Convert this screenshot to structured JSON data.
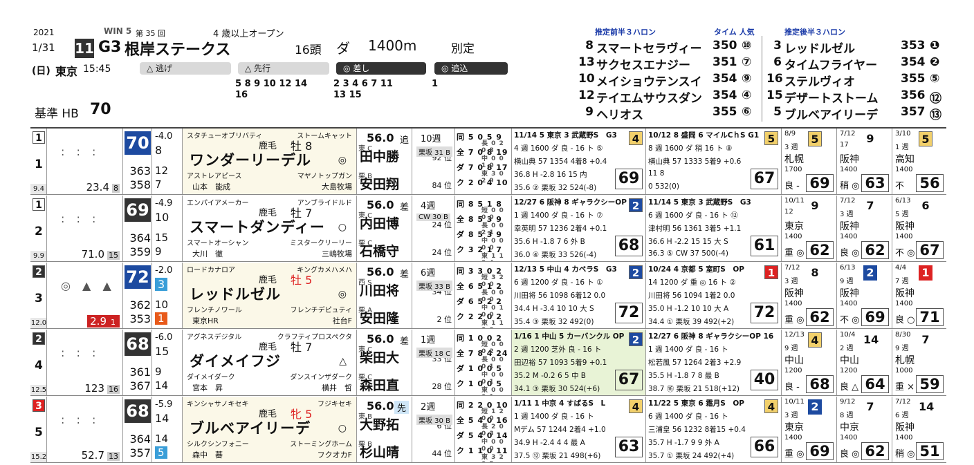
{
  "header": {
    "year": "2021",
    "date": "1/31",
    "win5": "WIN 5",
    "kai": "第 35 回",
    "cond": "4 歳以上オープン",
    "race_no": "11",
    "grade": "G3",
    "race_name": "根岸ステークス",
    "heads": "16頭",
    "surface": "ダ",
    "distance": "1400m",
    "weight_rule": "別定",
    "day": "(日)",
    "venue": "東京",
    "time": "15:45",
    "base_label": "基準 HB",
    "base_value": "70"
  },
  "pace": [
    {
      "label": "△ 逃げ",
      "nums1": "",
      "nums2": ""
    },
    {
      "label": "△ 先行",
      "nums1": "5 8 9 10 12 14",
      "nums2": "16"
    },
    {
      "label": "◎ 差し",
      "nums1": "2 3 4 6 7 11",
      "nums2": "13 15"
    },
    {
      "label": "◎ 追込",
      "nums1": "1",
      "nums2": ""
    }
  ],
  "pred_front": {
    "title": "推定前半３ハロン",
    "col": "タイム 人気",
    "rows": [
      {
        "no": "8",
        "name": "スマートセラヴィー",
        "time": "350",
        "pop": "⑩"
      },
      {
        "no": "13",
        "name": "サクセスエナジー",
        "time": "351",
        "pop": "⑦"
      },
      {
        "no": "10",
        "name": "メイショウテンスイ",
        "time": "354",
        "pop": "⑨"
      },
      {
        "no": "12",
        "name": "テイエムサウスダン",
        "time": "354",
        "pop": "④"
      },
      {
        "no": "9",
        "name": "ヘリオス",
        "time": "355",
        "pop": "⑥"
      }
    ]
  },
  "pred_back": {
    "title": "推定後半３ハロン",
    "rows": [
      {
        "no": "3",
        "name": "レッドルゼル",
        "time": "353",
        "pop": "❶"
      },
      {
        "no": "6",
        "name": "タイムフライヤー",
        "time": "354",
        "pop": "❷"
      },
      {
        "no": "16",
        "name": "ステルヴィオ",
        "time": "355",
        "pop": "⑤"
      },
      {
        "no": "15",
        "name": "デザートストーム",
        "time": "356",
        "pop": "⑫"
      },
      {
        "no": "5",
        "name": "ブルベアイリーデ",
        "time": "357",
        "pop": "⑬"
      }
    ]
  },
  "horses": [
    {
      "waku": "1",
      "umaban": "1",
      "odds_rank": "9.4",
      "marks": ": : :",
      "odds": "23.4",
      "pop": "8",
      "index": "70",
      "idx_style": "blue",
      "d1": "-4.0",
      "d1b": "8",
      "r1": "363",
      "r1b": "12",
      "r2": "358",
      "r2b": "7",
      "sire": "スタチューオブリバティ",
      "sire2": "ストームキャット",
      "coat": "鹿毛",
      "sex": "牡 8",
      "name": "ワンダーリーデル",
      "mark": "◎",
      "dam": "アストレアピース",
      "dam2": "マヤノトップガン",
      "trainer": "山本　能成",
      "owner": "大島牧場",
      "weight": "56.0",
      "style": "追",
      "j_tag": "東 C",
      "jockey": "田中勝",
      "j_rank": "92 位",
      "j2_tag": "栗 B",
      "jockey2": "安田翔",
      "j2_rank": "84 位",
      "week": "10週",
      "train": "栗坂 31 B",
      "stats": [
        "同 5 0 5 9",
        "全 7 0 8 19",
        "ダ 7 0 8 17",
        "ク 2 0 4 10"
      ],
      "stats2": [
        "長 0 2 0 8",
        "中 0 0 1 0",
        "東 3 0 2 9",
        ""
      ],
      "pr1": [
        "11/14 5 東京 3 武蔵野S　G3",
        "4 週 1600 ダ 良 - 16 ト ⑤",
        "横山典 57 1354 4着8 +0.4",
        "36.8 H -2.8 16 15 内",
        "35.6 ② 栗坂 32 524(-8)"
      ],
      "pr1_score": "69",
      "pr1_rank": "4",
      "pr1_style": "",
      "pr2": [
        "10/12 8 盛岡 6 マイルCｈS G1",
        "8 週 1600 ダ 稍 16 ト ⑧",
        "横山典 57 1333 5着9 +0.6",
        "11 8",
        "0 532(0)"
      ],
      "pr2_score": "67",
      "pr2_rank": "5",
      "pr2_style": "",
      "m1": [
        "8/9",
        "3 週",
        "札幌",
        "1700",
        "良 -"
      ],
      "m1_rank": "5",
      "m1_style": "boxed",
      "m1_score": "69",
      "m2": [
        "7/12",
        "17",
        "阪神",
        "1400",
        "稍 ◎"
      ],
      "m2_rank": "9",
      "m2_style": "",
      "m2_score": "63",
      "m3": [
        "3/10",
        "1 週",
        "高知",
        "1400",
        "不"
      ],
      "m3_rank": "5",
      "m3_style": "boxed",
      "m3_score": "56"
    },
    {
      "waku": "1",
      "umaban": "2",
      "odds_rank": "9.9",
      "marks": ": : :",
      "odds": "71.0",
      "pop": "15",
      "index": "69",
      "idx_style": "dark",
      "d1": "-4.9",
      "d1b": "10",
      "r1": "364",
      "r1b": "15",
      "r2": "359",
      "r2b": "9",
      "sire": "エンパイアメーカー",
      "sire2": "アンブライドルド",
      "coat": "鹿毛",
      "sex": "牡 7",
      "name": "スマートダンディー",
      "mark": "○",
      "dam": "スマートオーシャン",
      "dam2": "ミスタークリーリー",
      "trainer": "大川　徹",
      "owner": "三嶋牧場",
      "weight": "56.0",
      "style": "差",
      "j_tag": "東 C",
      "jockey": "内田博",
      "j_rank": "24 位",
      "j2_tag": "栗 C",
      "jockey2": "石橋守",
      "j2_rank": "24 位",
      "week": "4週",
      "train": "CW 30 B",
      "stats": [
        "同 8 5 1 8",
        "全 8 5 3 9",
        "ダ 8 5 3 9",
        "ク 3 2 1 7"
      ],
      "stats2": [
        "短 0 0 0 0",
        "長 0 0 2 1",
        "中 0 0 0 0",
        "東 1 1 3 4"
      ],
      "pr1": [
        "12/27 6 阪神 8 ギャラクシーOP",
        "1 週 1400 ダ 良 - 16 ト ⑦",
        "幸英明 57 1236 2着4 +0.1",
        "35.6 H -1.8 7 6 外 B",
        "36.0 ④ 栗坂 33 526(-4)"
      ],
      "pr1_score": "68",
      "pr1_rank": "2",
      "pr1_style": "blue",
      "pr2": [
        "11/14 5 東京 3 武蔵野S　G3",
        "6 週 1600 ダ 良 - 16 ト ⑫",
        "津村明 56 1361 3着5 +1.1",
        "36.6 H -2.2 15 15 大 S",
        "36.3 ⑤ CW 37 500(-4)"
      ],
      "pr2_score": "61",
      "pr2_rank": "",
      "pr2_style": "",
      "m1": [
        "10/11",
        "12",
        "東京",
        "1400",
        "重 ◎"
      ],
      "m1_rank": "9",
      "m1_style": "",
      "m1_score": "62",
      "m2": [
        "7/12",
        "3 週",
        "阪神",
        "1400",
        "良 ◎"
      ],
      "m2_rank": "7",
      "m2_style": "",
      "m2_score": "62",
      "m3": [
        "6/13",
        "5 週",
        "阪神",
        "1400",
        "不 ◎"
      ],
      "m3_rank": "6",
      "m3_style": "",
      "m3_score": "67"
    },
    {
      "waku": "2",
      "umaban": "3",
      "odds_rank": "12.0",
      "marks": "◎ ▲ ▲",
      "odds": "2.9",
      "pop": "1",
      "index": "72",
      "idx_style": "blue",
      "d1": "-2.0",
      "d1b": "3",
      "r1": "362",
      "r1b": "10",
      "r2": "353",
      "r2b": "1",
      "sire": "ロードカナロア",
      "sire2": "キングカメハメハ",
      "coat": "鹿毛",
      "sex": "牡 5",
      "name": "レッドルゼル",
      "mark": "◎",
      "dam": "フレンチノワール",
      "dam2": "フレンチデピュティ",
      "trainer": "東京HR",
      "owner": "社台F",
      "weight": "56.0",
      "style": "差",
      "j_tag": "西 S",
      "jockey": "川田将",
      "j_rank": "34 位",
      "j2_tag": "栗 A",
      "jockey2": "安田隆",
      "j2_rank": "2 位",
      "week": "6週",
      "train": "栗坂 33 B",
      "stats": [
        "同 3 3 0 2",
        "全 6 5 1 2",
        "ダ 6 5 2 2",
        "ク 2 2 0 2"
      ],
      "stats2": [
        "短 3 2 0 0",
        "長 0 0 0 0",
        "中 0 1 0 0",
        "東 1 1 0 0"
      ],
      "pr1": [
        "12/13 5 中山 4 カペラS　G3",
        "6 週 1200 ダ 良 - 16 ト ①",
        "川田将 56 1098 6着12 0.0",
        "34.4 H -3.4 10 10 大 S",
        "35.4 ③ 栗坂 32 492(0)"
      ],
      "pr1_score": "72",
      "pr1_rank": "2",
      "pr1_style": "blue",
      "pr2": [
        "10/24 4 京都 5 室町S　OP",
        "14 1200 ダ 重 ◎ 16 ト ②",
        "川田将 56 1094 1着2 0.0",
        "35.0 H -1.2 10 10 大 A",
        "34.4 ① 栗坂 39 492(+2)"
      ],
      "pr2_score": "72",
      "pr2_rank": "1",
      "pr2_style": "red",
      "m1": [
        "7/12",
        "3 週",
        "阪神",
        "1400",
        "重 ◎"
      ],
      "m1_rank": "8",
      "m1_style": "",
      "m1_score": "62",
      "m2": [
        "6/13",
        "9 週",
        "阪神",
        "1400",
        "不 ◎"
      ],
      "m2_rank": "2",
      "m2_style": "blue",
      "m2_score": "69",
      "m3": [
        "4/4",
        "7 週",
        "阪神",
        "1400",
        "良 ○"
      ],
      "m3_rank": "1",
      "m3_style": "red",
      "m3_score": "71"
    },
    {
      "waku": "2",
      "umaban": "4",
      "odds_rank": "12.5",
      "marks": ": : :",
      "odds": "123",
      "pop": "16",
      "index": "68",
      "idx_style": "dark",
      "d1": "-6.0",
      "d1b": "15",
      "r1": "361",
      "r1b": "9",
      "r2": "367",
      "r2b": "14",
      "sire": "アグネスデジタル",
      "sire2": "クラフティプロスペクタ",
      "coat": "鹿毛",
      "sex": "牡 7",
      "name": "ダイメイフジ",
      "mark": "△",
      "dam": "ダイメイダーク",
      "dam2": "ダンスインザダーク",
      "trainer": "宮本　昇",
      "owner": "横井　哲",
      "weight": "56.0",
      "style": "差",
      "j_tag": "東 C",
      "jockey": "柴田大",
      "j_rank": "33 位",
      "j2_tag": "栗 C",
      "jockey2": "森田直",
      "j2_rank": "28 位",
      "week": "1週",
      "train": "栗坂 18 C",
      "stats": [
        "同 1 0 0 2",
        "全 7 8 4 24",
        "ダ 1 0 0 5",
        "ク 1 0 0 5"
      ],
      "stats2": [
        "短 0 0 0 2",
        "長 0 0 0 1",
        "中 0 0 0 1",
        "東 0 0 0 1"
      ],
      "pr1": [
        "1/16 1 中山 5 カーバンクル OP",
        "2 週 1200 芝外 良 - 16 ト",
        "田辺裕 57 1093 5着9 +0.1",
        "35.2 M -0.2 6 5 中 B",
        "34.1 ③ 栗坂 30 524(+6)"
      ],
      "pr1_score": "67",
      "pr1_rank": "2",
      "pr1_style": "blue",
      "pr2": [
        "12/27 6 阪神 8 ギャラクシーOP 16",
        "1 週 1400 ダ 良 - 16 ト",
        "松若風 57 1264 2着3 +2.9",
        "35.5 H -1.8 7 8 最 B",
        "38.7 ⑯ 栗坂 21 518(+12)"
      ],
      "pr2_score": "40",
      "pr2_rank": "",
      "pr2_style": "",
      "m1": [
        "12/13",
        "9 週",
        "中山",
        "1200",
        "良 -"
      ],
      "m1_rank": "4",
      "m1_style": "boxed",
      "m1_score": "68",
      "m2": [
        "10/4",
        "2 週",
        "中山",
        "1200",
        "良 △"
      ],
      "m2_rank": "14",
      "m2_style": "",
      "m2_score": "64",
      "m3": [
        "8/30",
        "9 週",
        "札幌",
        "1000",
        "重 ×"
      ],
      "m3_rank": "7",
      "m3_style": "",
      "m3_score": "59"
    },
    {
      "waku": "3",
      "umaban": "5",
      "odds_rank": "15.2",
      "marks": ": : :",
      "odds": "52.7",
      "pop": "13",
      "index": "68",
      "idx_style": "dark",
      "d1": "-5.9",
      "d1b": "14",
      "r1": "364",
      "r1b": "14",
      "r2": "357",
      "r2b": "5",
      "sire": "キンシャサノキセキ",
      "sire2": "フジキセキ",
      "coat": "鹿毛",
      "sex": "牝 5",
      "name": "ブルベアイリーデ",
      "mark": "○",
      "dam": "シルクシンフォニー",
      "dam2": "ストーミングホーム",
      "trainer": "森中　蕃",
      "owner": "フクオカF",
      "weight": "56.0",
      "style": "先",
      "j_tag": "東 B",
      "jockey": "大野拓",
      "j_rank": "6 位",
      "j2_tag": "栗 B",
      "jockey2": "杉山晴",
      "j2_rank": "44 位",
      "week": "2週",
      "train": "栗坂 30 B",
      "stats": [
        "同 2 2 0 10",
        "全 5 4 0 16",
        "ダ 5 4 0 14",
        "ク 1 1 0 11"
      ],
      "stats2": [
        "短 1 2 0 0",
        "長 2 0 0 3",
        "中 0 0 0 0",
        "東 3 2 0 5"
      ],
      "pr1": [
        "1/11 1 中京 4 すばるS　L",
        "1 週 1400 ダ 良 - 16 ト",
        "Mデム 57 1244 2着4 +1.0",
        "34.9 H -2.4 4 4 最 A",
        "37.5 ⑫ 栗坂 21 498(+6)"
      ],
      "pr1_score": "63",
      "pr1_rank": "4",
      "pr1_style": "",
      "pr2": [
        "11/22 5 東京 6 霜月S　OP",
        "6 週 1400 ダ 良 - 16 ト",
        "三浦皇 56 1232 8着15 +0.4",
        "35.7 H -1.7 9 9 外 A",
        "35.7 ① 栗坂 24 492(+4)"
      ],
      "pr2_score": "66",
      "pr2_rank": "4",
      "pr2_style": "",
      "m1": [
        "10/11",
        "3 週",
        "東京",
        "1400",
        "重 ◎"
      ],
      "m1_rank": "2",
      "m1_style": "blue",
      "m1_score": "69",
      "m2": [
        "9/12",
        "8 週",
        "中京",
        "1400",
        "良 ◎"
      ],
      "m2_rank": "7",
      "m2_style": "",
      "m2_score": "62",
      "m3": [
        "7/12",
        "6 週",
        "阪神",
        "1400",
        "稍 ◎"
      ],
      "m3_rank": "14",
      "m3_style": "",
      "m3_score": "51"
    }
  ],
  "colors": {
    "index_blue": "#1d4aa0",
    "index_dark": "#333333",
    "rank_yellow": "#f2d06b",
    "rank_red": "#dd2222",
    "header_blue": "#1a3aa8"
  }
}
